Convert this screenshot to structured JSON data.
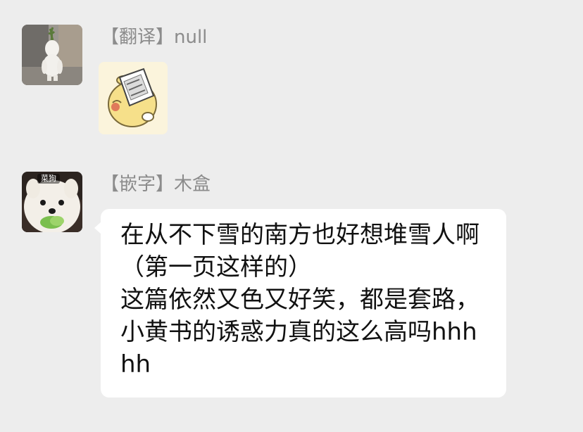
{
  "messages": [
    {
      "sender": "【翻译】null",
      "avatar_icon": "figure-with-plant-avatar",
      "sticker_icon": "cartoon-reading-book-sticker"
    },
    {
      "sender": "【嵌字】木盒",
      "avatar_icon": "samoyed-dog-avatar",
      "avatar_label": "菜狗",
      "text": "在从不下雪的南方也好想堆雪人啊（第一页这样的）\n这篇依然又色又好笑，都是套路，小黄书的诱惑力真的这么高吗hhhhh"
    }
  ],
  "colors": {
    "background": "#ededed",
    "bubble": "#ffffff",
    "sender_name": "#8c8c8c",
    "message_text": "#111111"
  }
}
